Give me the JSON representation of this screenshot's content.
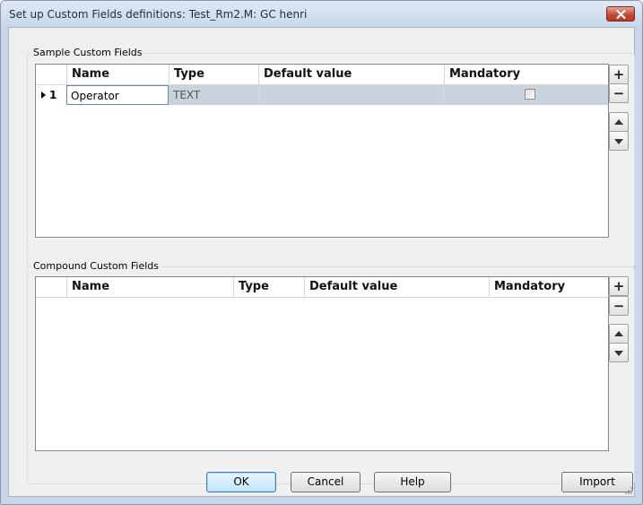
{
  "window": {
    "title": "Set up Custom Fields definitions: Test_Rm2.M: GC henri"
  },
  "sample_fields": {
    "group_label": "Sample Custom Fields",
    "columns": [
      "Name",
      "Type",
      "Default value",
      "Mandatory"
    ],
    "rows": [
      {
        "index": "1",
        "name": "Operator",
        "type": "TEXT",
        "default_value": "",
        "mandatory": false
      }
    ],
    "side_buttons": {
      "add": "+",
      "remove": "−"
    }
  },
  "compound_fields": {
    "group_label": "Compound Custom Fields",
    "columns": [
      "Name",
      "Type",
      "Default value",
      "Mandatory"
    ],
    "rows": [],
    "side_buttons": {
      "add": "+",
      "remove": "−"
    }
  },
  "buttons": {
    "ok": "OK",
    "cancel": "Cancel",
    "help": "Help",
    "import": "Import"
  },
  "colors": {
    "title_bar": "#c7d7ea",
    "close_button": "#c44b35",
    "selected_row": "#c9d3de",
    "dialog_background": "#f0f0f0"
  }
}
